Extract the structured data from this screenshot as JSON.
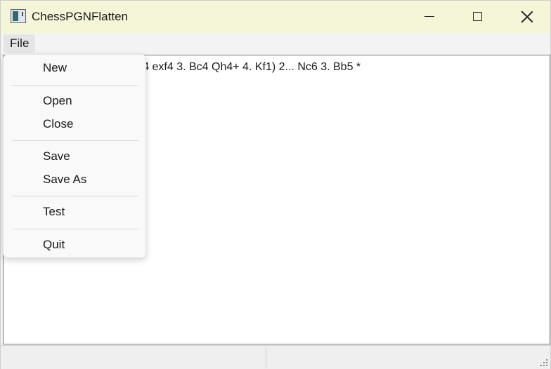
{
  "window": {
    "title": "ChessPGNFlatten",
    "controls": [
      "minimize",
      "maximize",
      "close"
    ],
    "icon": "chess-app-icon"
  },
  "menubar": {
    "file_label": "File"
  },
  "file_menu": {
    "new": "New",
    "open": "Open",
    "close": "Close",
    "save": "Save",
    "save_as": "Save As",
    "test": "Test",
    "quit": "Quit"
  },
  "editor": {
    "visible_text": "Nc3 Nf6) 1... e5 2. Nf3 (2. f4 exf4 3. Bc4 Qh4+ 4. Kf1) 2... Nc6 3. Bb5 *"
  },
  "statusbar": {
    "left": "",
    "right": ""
  },
  "colors": {
    "titlebar": "#f5f5d8",
    "menu_bg": "#f9f9f9",
    "editor_bg": "#ffffff"
  }
}
